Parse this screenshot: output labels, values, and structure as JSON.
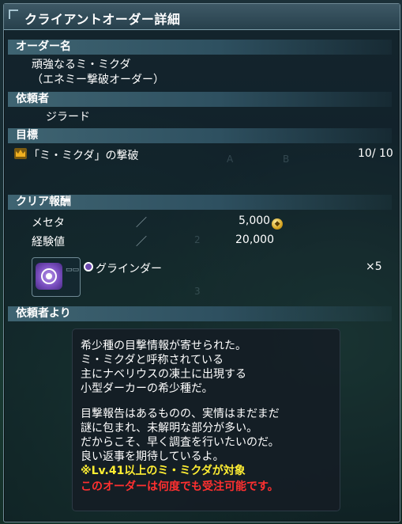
{
  "window": {
    "title": "クライアントオーダー詳細"
  },
  "order_name": {
    "header": "オーダー名",
    "line1": "頑強なるミ・ミクダ",
    "line2": "（エネミー撃破オーダー）"
  },
  "client": {
    "header": "依頼者",
    "name": "ジラード"
  },
  "goal": {
    "header": "目標",
    "text": "「ミ・ミクダ」の撃破",
    "progress_text": "10/ 10",
    "current": 10,
    "total": 10
  },
  "reward": {
    "header": "クリア報酬",
    "rows": [
      {
        "label": "メセタ",
        "sep": "／",
        "value": "5,000"
      },
      {
        "label": "経験値",
        "sep": "／",
        "value": "20,000"
      }
    ],
    "item": {
      "name": "グラインダー",
      "qty": "×5"
    }
  },
  "message": {
    "header": "依頼者より",
    "lines": [
      "希少種の目撃情報が寄せられた。",
      "ミ・ミクダと呼称されている",
      "主にナベリウスの凍土に出現する",
      "小型ダーカーの希少種だ。",
      "",
      "目撃報告はあるものの、実情はまだまだ",
      "謎に包まれ、未解明な部分が多い。",
      "だからこそ、早く調査を行いたいのだ。",
      "良い返事を期待しているよ。"
    ],
    "note_yellow": "※Lv.41以上のミ・ミクダが対象",
    "note_red": "このオーダーは何度でも受注可能です。"
  },
  "colors": {
    "header_bg": "#355968",
    "note_yellow": "#ffee33",
    "note_red": "#ff3030",
    "crown": "#f0b020",
    "item_icon": "#8a5fd0"
  },
  "icons": [
    "crown-icon",
    "meseta-coin-icon",
    "grinder-disc-icon"
  ]
}
